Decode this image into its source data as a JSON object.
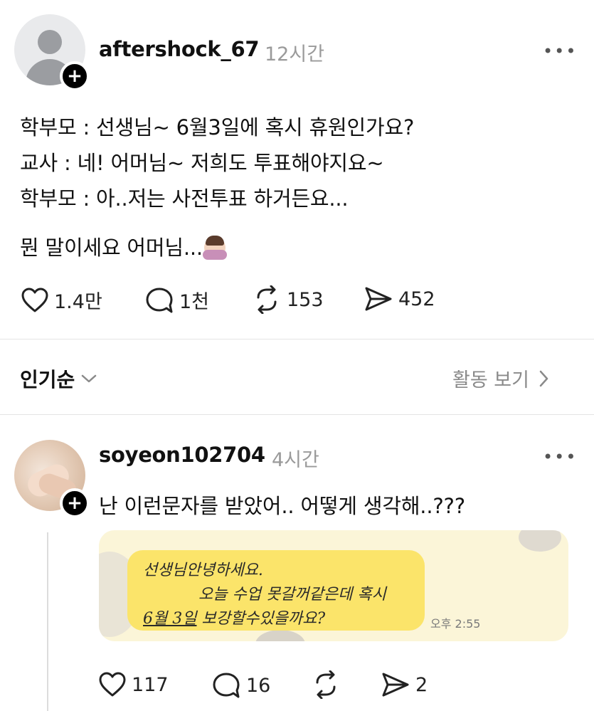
{
  "post": {
    "username": "aftershock_67",
    "time": "12시간",
    "more": "•••",
    "lines": [
      "학부모 : 선생님~ 6월3일에 혹시 휴원인가요?",
      "교사 : 네! 어머님~ 저희도 투표해야지요~",
      "학부모 : 아..저는 사전투표 하거든요...",
      "뭔 말이세요 어머님..."
    ],
    "emoji": "facepalm-emoji",
    "actions": {
      "likes": "1.4만",
      "comments": "1천",
      "reposts": "153",
      "shares": "452"
    }
  },
  "sort_bar": {
    "sort_label": "인기순",
    "activity_label": "활동 보기"
  },
  "comment": {
    "username": "soyeon102704",
    "time": "4시간",
    "more": "•••",
    "text": "난 이런문자를 받았어.. 어떻게 생각해..???",
    "attached_message": {
      "line1": "선생님안녕하세요.",
      "line2": "오늘 수업 못갈꺼같은데 혹시",
      "line3_underlined": "6월 3일",
      "line3_rest": " 보강할수있을까요?",
      "time": "오후 2:55"
    },
    "actions": {
      "likes": "117",
      "comments": "16",
      "reposts": "",
      "shares": "2"
    }
  },
  "colors": {
    "text": "#111111",
    "muted": "#9a9a9a",
    "bubble": "#fbe46a",
    "follow_button": "#000000"
  }
}
